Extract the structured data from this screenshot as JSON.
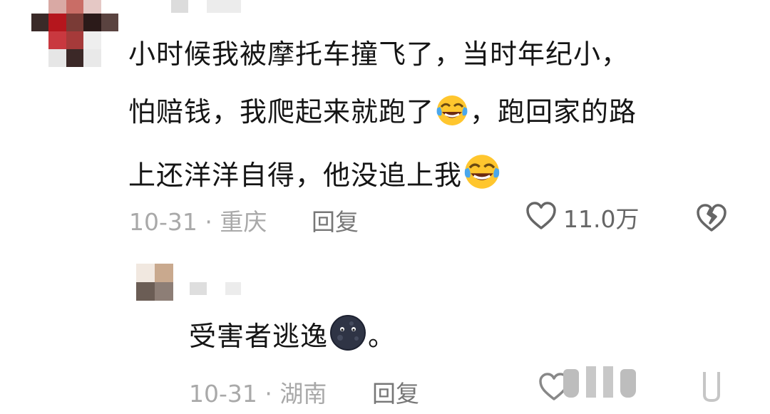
{
  "comment": {
    "lines": [
      "小时候我被摩托车撞飞了，当时年纪小，",
      "怕赔钱，我爬起来就跑了",
      "，跑回家的路",
      "上还洋洋自得，他没追上我"
    ],
    "emoji": "laughing-crying-emoji",
    "date": "10-31",
    "separator": "·",
    "location": "重庆",
    "reply_label": "回复",
    "like_count": "11.0万"
  },
  "reply": {
    "text": "受害者逃逸",
    "text_end": "。",
    "emoji": "dark-moon-face-emoji",
    "date": "10-31",
    "separator": "·",
    "location": "湖南",
    "reply_label": "回复"
  },
  "colors": {
    "text": "#151515",
    "meta": "#a9a9a9",
    "icon": "#666666"
  }
}
